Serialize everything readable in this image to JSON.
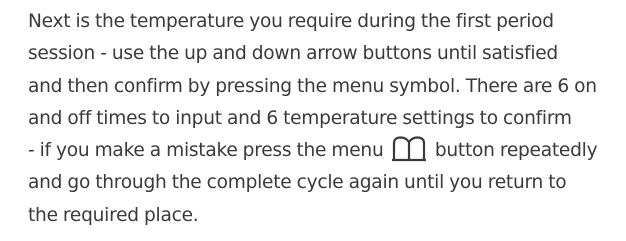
{
  "paragraph": {
    "lines": [
      "Next is the temperature you require during the first period",
      "session - use the up and down arrow buttons until satisfied",
      "and then confirm by pressing the menu symbol. There are 6 on",
      "and off times to input and 6 temperature settings to confirm",
      "- if you make a mistake press the menu",
      "button repeatedly",
      "and go through the complete cycle again until you return to",
      "the required place."
    ],
    "inline_icon": "menu-book-icon"
  }
}
